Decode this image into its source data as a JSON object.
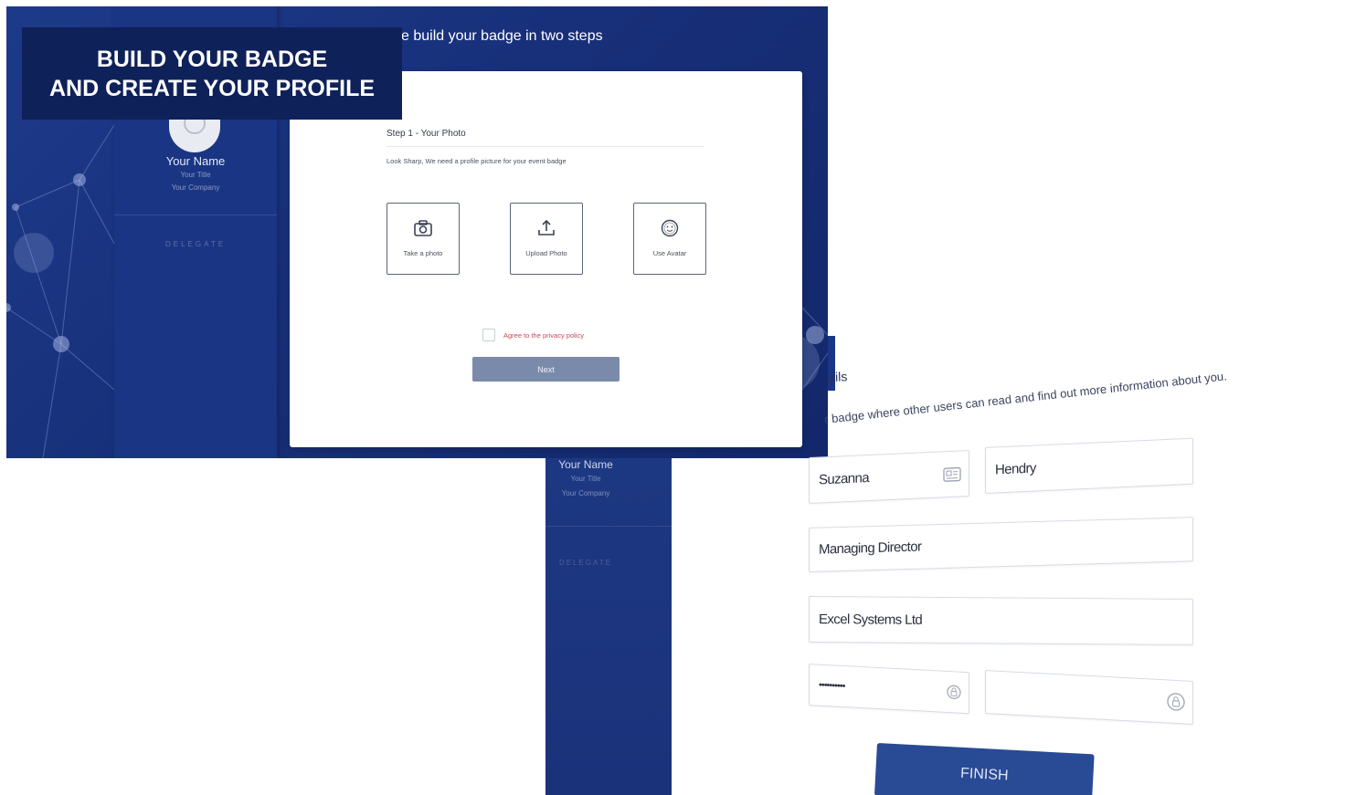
{
  "screen1": {
    "banner": {
      "line1": "BUILD YOUR BADGE",
      "line2": "AND CREATE YOUR PROFILE"
    },
    "header": "e build your badge in two steps",
    "sidebar": {
      "name": "Your Name",
      "title": "Your Title",
      "company": "Your Company",
      "role": "DELEGATE"
    },
    "step": {
      "title": "Step 1 - Your Photo",
      "description": "Look Sharp, We need a profile picture for your event badge",
      "options": [
        {
          "label": "Take a photo",
          "icon": "camera-icon"
        },
        {
          "label": "Upload Photo",
          "icon": "upload-icon"
        },
        {
          "label": "Use Avatar",
          "icon": "avatar-face-icon"
        }
      ],
      "agree_label": "Agree to the privacy policy",
      "next_label": "Next"
    }
  },
  "screen2": {
    "heading": "ails",
    "subtitle": "r badge where other users can read and find out more information about you.",
    "sidebar": {
      "name": "Your Name",
      "title": "Your Title",
      "company": "Your Company",
      "role": "DELEGATE"
    },
    "form": {
      "first_name": "Suzanna",
      "last_name": "Hendry",
      "job_title": "Managing Director",
      "company": "Excel Systems Ltd",
      "password": "••••••••••",
      "confirm_password": ""
    },
    "finish_label": "FINISH"
  },
  "colors": {
    "navy_background": "#18307a",
    "banner_navy": "#0f2159",
    "next_button": "#7a8aab",
    "finish_button": "#294a95",
    "privacy_text": "#c8485c"
  }
}
